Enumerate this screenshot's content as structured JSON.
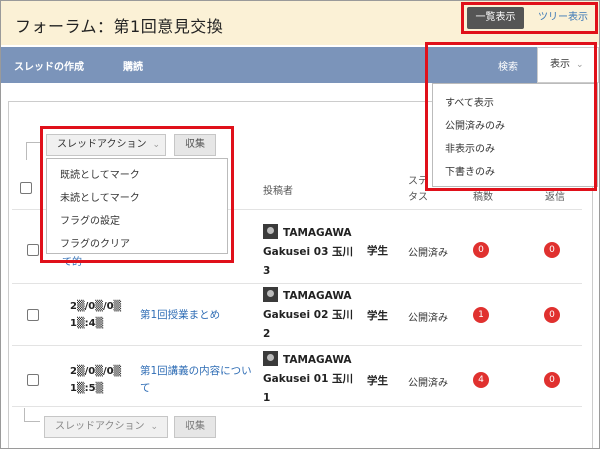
{
  "header": {
    "title": "フォーラム：第1回意見交換",
    "view_list": "一覧表示",
    "view_tree": "ツリー表示"
  },
  "navbar": {
    "create_thread": "スレッドの作成",
    "subscribe": "購読",
    "search": "検索",
    "display": "表示"
  },
  "display_menu": {
    "items": [
      "すべて表示",
      "公開済みのみ",
      "非表示のみ",
      "下書きのみ"
    ]
  },
  "toolbar": {
    "thread_action": "スレッドアクション",
    "collect": "収集"
  },
  "thread_action_menu": {
    "items": [
      "既読としてマーク",
      "未読としてマーク",
      "フラグの設定",
      "フラグのクリア"
    ]
  },
  "table": {
    "headers": {
      "author": "投稿者",
      "status_1": "ステ",
      "status_2": "タス",
      "count": "稿数",
      "reply": "返信"
    },
    "partial_title": "て的",
    "rows": [
      {
        "date_1": "",
        "date_2": "",
        "title": "",
        "author_1": "TAMAGAWA",
        "author_2": "Gakusei 03 玉川",
        "author_3": "3",
        "role": "学生",
        "status": "公開済み",
        "unread": "0",
        "replies": "0"
      },
      {
        "date_1": "2▒/0▒/0▒",
        "date_2": "1▒:4▒",
        "title": "第1回授業まとめ",
        "author_1": "TAMAGAWA",
        "author_2": "Gakusei 02 玉川",
        "author_3": "2",
        "role": "学生",
        "status": "公開済み",
        "unread": "1",
        "replies": "0"
      },
      {
        "date_1": "2▒/0▒/0▒",
        "date_2": "1▒:5▒",
        "title_1": "第1回講義の内容につい",
        "title_2": "て",
        "author_1": "TAMAGAWA",
        "author_2": "Gakusei 01 玉川",
        "author_3": "1",
        "role": "学生",
        "status": "公開済み",
        "unread": "4",
        "replies": "0"
      }
    ]
  },
  "colors": {
    "header_bg": "#fbf1d6",
    "navbar_bg": "#7b94ba",
    "highlight": "#e0101a",
    "badge": "#e0312f",
    "link": "#2f6db5"
  }
}
